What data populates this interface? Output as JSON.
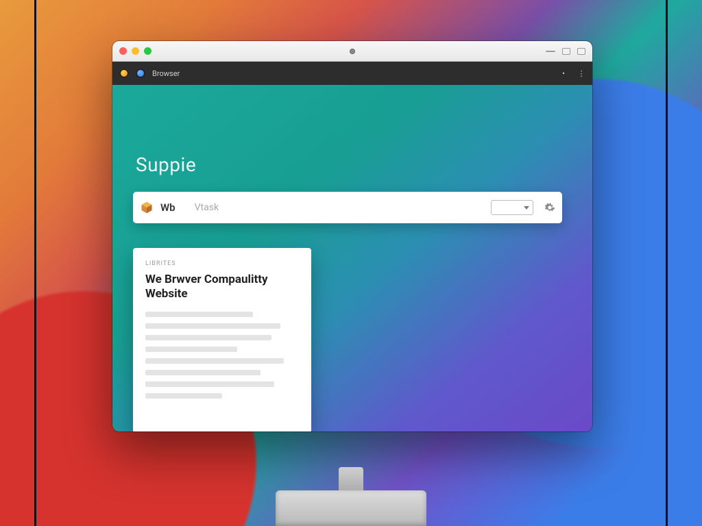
{
  "tab": {
    "label": "Browser"
  },
  "page": {
    "brand": "Suppie",
    "search": {
      "prefix": "Wb",
      "placeholder": "Vtask"
    },
    "document": {
      "eyebrow": "LIBRITES",
      "title_line1": "We Brwver Compaulitty",
      "title_line2": "Website"
    }
  }
}
